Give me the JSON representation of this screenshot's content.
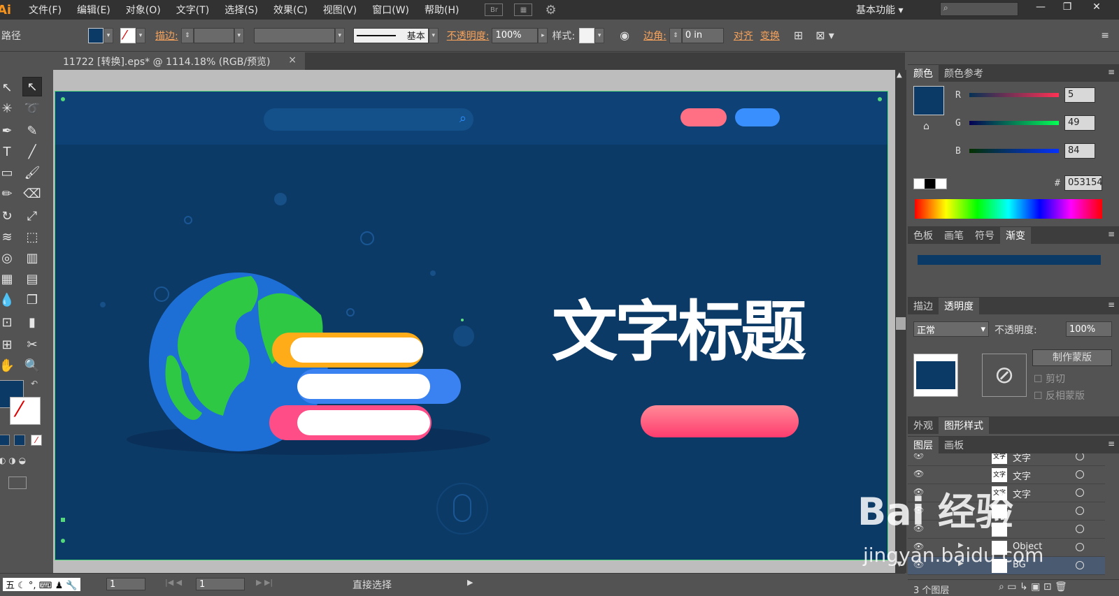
{
  "app": {
    "logo": "Ai",
    "menu": [
      "文件(F)",
      "编辑(E)",
      "对象(O)",
      "文字(T)",
      "选择(S)",
      "效果(C)",
      "视图(V)",
      "窗口(W)",
      "帮助(H)"
    ],
    "bridge_icon": "Br",
    "workspace": "基本功能",
    "window_buttons": [
      "—",
      "❐",
      "✕"
    ]
  },
  "control_bar": {
    "object_type": "路径",
    "stroke_label": "描边",
    "stroke_style": "基本",
    "opacity_label": "不透明度",
    "opacity_value": "100%",
    "style_label": "样式",
    "corner_label": "边角",
    "corner_value": "0 in",
    "align_label": "对齐",
    "transform_label": "变换",
    "fill_color": "#0c3a67"
  },
  "document": {
    "tab_title": "11722 [转换].eps* @ 1114.18% (RGB/预览)",
    "close": "×"
  },
  "artboard": {
    "headline": "文字标题",
    "bg_color": "#0c3a67"
  },
  "color_panel": {
    "tabs": [
      "颜色",
      "颜色参考"
    ],
    "r_label": "R",
    "g_label": "G",
    "b_label": "B",
    "r": 5,
    "g": 49,
    "b": 84,
    "hex_label": "#",
    "hex": "053154"
  },
  "swatch_panel": {
    "tabs": [
      "色板",
      "画笔",
      "符号",
      "渐变"
    ]
  },
  "transparency_panel": {
    "tabs": [
      "描边",
      "透明度"
    ],
    "blend_mode": "正常",
    "opacity_label": "不透明度",
    "opacity_value": "100%",
    "make_mask": "制作蒙版",
    "clip": "剪切",
    "invert_mask": "反相蒙版"
  },
  "appearance_panel": {
    "tabs": [
      "外观",
      "图形样式"
    ]
  },
  "layers_panel": {
    "tabs": [
      "图层",
      "画板"
    ],
    "rows": [
      {
        "thumb": "文字",
        "name": "文字"
      },
      {
        "thumb": "文字",
        "name": "文字"
      },
      {
        "thumb": "文字",
        "name": "文字"
      },
      {
        "thumb": "",
        "name": ""
      },
      {
        "thumb": "",
        "name": ""
      },
      {
        "thumb": "",
        "name": "Object"
      },
      {
        "thumb": "",
        "name": "BG"
      }
    ],
    "count": "3 个图层"
  },
  "status_bar": {
    "ime": "五",
    "zoom": "1",
    "page": "1",
    "tool_name": "直接选择"
  },
  "watermark": {
    "brand": "Bai 经验",
    "url": "jingyan.baidu.com"
  }
}
